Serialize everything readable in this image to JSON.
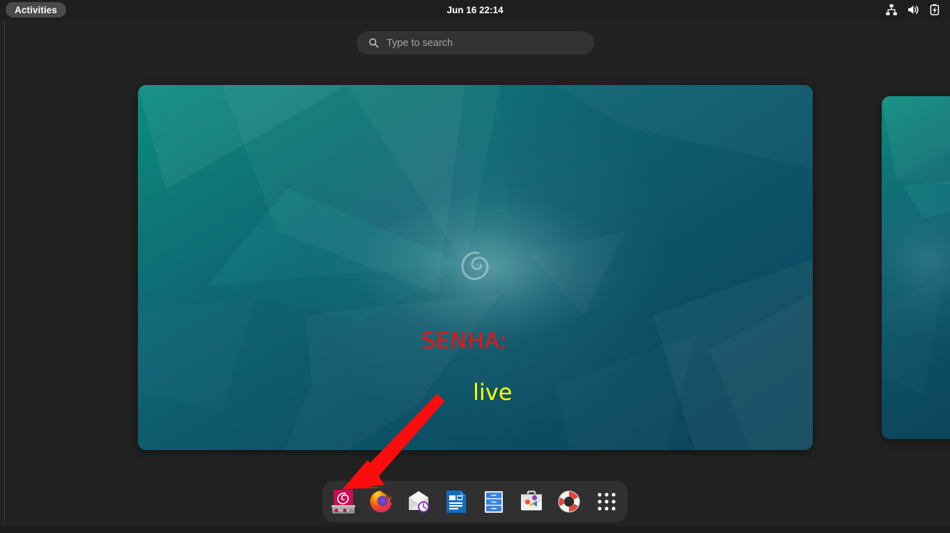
{
  "topbar": {
    "activities_label": "Activities",
    "clock": {
      "date": "Jun 16",
      "time": "22:14",
      "full": "Jun 16  22:14"
    },
    "system_icons": [
      {
        "name": "wired-network-icon",
        "label": "Wired Network"
      },
      {
        "name": "volume-icon",
        "label": "Volume"
      },
      {
        "name": "battery-charging-icon",
        "label": "Battery Charging"
      }
    ]
  },
  "search": {
    "placeholder": "Type to search",
    "value": "",
    "icon": "search-icon"
  },
  "overview": {
    "windows": [
      {
        "name": "workspace-thumbnail-main",
        "wallpaper": "debian-low-poly-teal",
        "logo": "debian-swirl"
      },
      {
        "name": "workspace-thumbnail-next",
        "wallpaper": "debian-low-poly-teal",
        "logo": ""
      }
    ]
  },
  "annotations": {
    "password_label": "SENHA:",
    "password_value": "live",
    "arrow": {
      "name": "red-arrow-pointer",
      "target": "debian-installer-icon",
      "color": "#fb0d0d"
    }
  },
  "dock": {
    "items": [
      {
        "name": "debian-installer-icon",
        "label": "Install Debian"
      },
      {
        "name": "firefox-icon",
        "label": "Firefox ESR"
      },
      {
        "name": "evolution-mail-icon",
        "label": "Evolution"
      },
      {
        "name": "libreoffice-writer-icon",
        "label": "LibreOffice Writer"
      },
      {
        "name": "files-icon",
        "label": "Files"
      },
      {
        "name": "software-icon",
        "label": "Software"
      },
      {
        "name": "help-icon",
        "label": "Help"
      },
      {
        "name": "app-grid-icon",
        "label": "Show Applications"
      }
    ]
  },
  "colors": {
    "topbar_bg": "#1e1e1e",
    "desktop_bg": "#222222",
    "dock_bg": "#303030",
    "search_bg": "#333333",
    "accent_red": "#fb0d0d",
    "accent_yellow": "#ffff00",
    "wallpaper_teal": "#0d5263",
    "debian_crimson": "#c70martn"
  }
}
